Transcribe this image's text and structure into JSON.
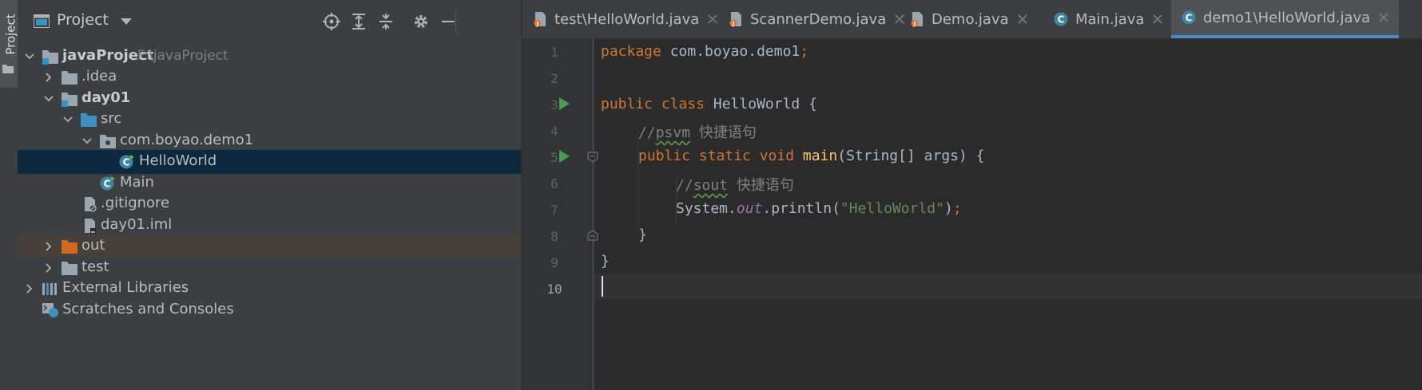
{
  "tool_strip": {
    "label": "Project"
  },
  "project_panel": {
    "title": "Project",
    "tree": [
      {
        "name": "javaProject",
        "hint": "F:\\javaProject",
        "kind": "module",
        "bold": true
      },
      {
        "name": ".idea",
        "kind": "folder"
      },
      {
        "name": "day01",
        "kind": "module",
        "bold": true
      },
      {
        "name": "src",
        "kind": "source-folder"
      },
      {
        "name": "com.boyao.demo1",
        "kind": "package"
      },
      {
        "name": "HelloWorld",
        "kind": "class",
        "selected": true
      },
      {
        "name": "Main",
        "kind": "class"
      },
      {
        "name": ".gitignore",
        "kind": "file"
      },
      {
        "name": "day01.iml",
        "kind": "file"
      },
      {
        "name": "out",
        "kind": "excluded-folder"
      },
      {
        "name": "test",
        "kind": "folder"
      },
      {
        "name": "External Libraries",
        "kind": "libraries"
      },
      {
        "name": "Scratches and Consoles",
        "kind": "scratches"
      }
    ]
  },
  "editor": {
    "tabs": [
      {
        "label": "test\\HelloWorld.java",
        "kind": "java-file",
        "active": false
      },
      {
        "label": "ScannerDemo.java",
        "kind": "java-file",
        "active": false
      },
      {
        "label": "Demo.java",
        "kind": "java-file",
        "active": false
      },
      {
        "label": "Main.java",
        "kind": "class",
        "active": false
      },
      {
        "label": "demo1\\HelloWorld.java",
        "kind": "class",
        "active": true
      }
    ],
    "line_numbers": [
      "1",
      "2",
      "3",
      "4",
      "5",
      "6",
      "7",
      "8",
      "9",
      "10"
    ],
    "current_line": 10,
    "code": {
      "l1_kw": "package",
      "l1_rest": " com.boyao.demo1",
      "l1_semi": ";",
      "l3_kw": "public class",
      "l3_rest": " HelloWorld {",
      "l4_slash": "//",
      "l4_word": "psvm",
      "l4_rest": " 快捷语句",
      "l5_kw": "public static void",
      "l5_fn": "main",
      "l5_rest": "(String[] args) {",
      "l6_slash": "//",
      "l6_word": "sout",
      "l6_rest": " 快捷语句",
      "l7_a": "System.",
      "l7_fld": "out",
      "l7_b": ".println(",
      "l7_str": "\"HelloWorld\"",
      "l7_c": ")",
      "l7_semi": ";",
      "l8": "}",
      "l9": "}"
    }
  },
  "colors": {
    "keyword": "#cc7832",
    "function": "#ffc66d",
    "string": "#6a8759",
    "comment": "#808080",
    "field": "#9876aa",
    "selection": "#0d293e",
    "active_tab_underline": "#4a88c7"
  }
}
